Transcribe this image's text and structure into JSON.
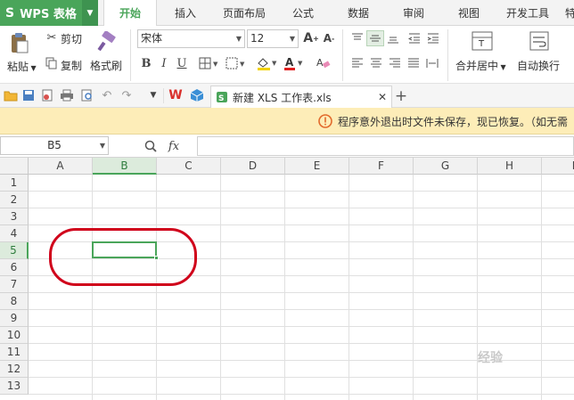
{
  "app": {
    "logo": "S",
    "name": "WPS 表格"
  },
  "menu": {
    "tabs": [
      {
        "label": "开始"
      },
      {
        "label": "插入"
      },
      {
        "label": "页面布局"
      },
      {
        "label": "公式"
      },
      {
        "label": "数据"
      },
      {
        "label": "审阅"
      },
      {
        "label": "视图"
      },
      {
        "label": "开发工具"
      },
      {
        "label": "特"
      }
    ]
  },
  "ribbon": {
    "cut": "剪切",
    "paste": "粘贴",
    "copy": "复制",
    "format_painter": "格式刷",
    "font_name": "宋体",
    "font_size": "12",
    "bold": "B",
    "italic": "I",
    "underline": "U",
    "merge_center": "合并居中",
    "wrap_text": "自动换行"
  },
  "doc": {
    "tab_title": "新建 XLS 工作表.xls"
  },
  "notice": {
    "text": "程序意外退出时文件未保存，现已恢复。（如无需"
  },
  "formula": {
    "name_box": "B5",
    "fx": "fx",
    "value": ""
  },
  "sheet": {
    "columns": [
      "A",
      "B",
      "C",
      "D",
      "E",
      "F",
      "G",
      "H",
      "I"
    ],
    "rows": [
      "1",
      "2",
      "3",
      "4",
      "5",
      "6",
      "7",
      "8",
      "9",
      "10",
      "11",
      "12",
      "13"
    ],
    "active_cell": "B5",
    "accent": "#4aa55a",
    "annotation_color": "#d0021b"
  }
}
